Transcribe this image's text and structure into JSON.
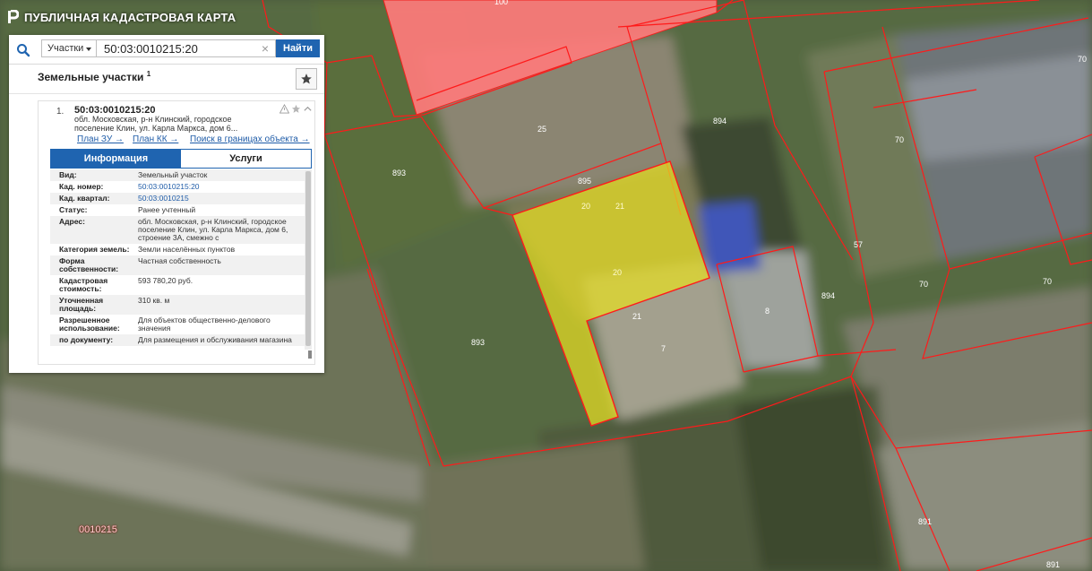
{
  "header": {
    "title": "ПУБЛИЧНАЯ КАДАСТРОВАЯ КАРТА"
  },
  "search": {
    "layer": "Участки",
    "value": "50:03:0010215:20",
    "button_label": "Найти",
    "clear_glyph": "×"
  },
  "results": {
    "title": "Земельные участки",
    "count": "1",
    "item": {
      "index": "1.",
      "cad_number": "50:03:0010215:20",
      "address_line1": "обл. Московская, р-н Клинский, городское",
      "address_line2": "поселение Клин, ул. Карла Маркса, дом 6...",
      "links": [
        "План ЗУ →",
        "План КК →",
        "Поиск в границах объекта →"
      ]
    }
  },
  "tabs": {
    "info": "Информация",
    "services": "Услуги"
  },
  "info_rows": [
    {
      "label": "Вид:",
      "value": "Земельный участок",
      "link": false
    },
    {
      "label": "Кад. номер:",
      "value": "50:03:0010215:20",
      "link": true
    },
    {
      "label": "Кад. квартал:",
      "value": "50:03:0010215",
      "link": true
    },
    {
      "label": "Статус:",
      "value": "Ранее учтенный",
      "link": false
    },
    {
      "label": "Адрес:",
      "value": "обл. Московская, р-н Клинский, городское поселение Клин, ул. Карла Маркса, дом 6, строение 3А, смежно с",
      "link": false
    },
    {
      "label": "Категория земель:",
      "value": "Земли населённых пунктов",
      "link": false
    },
    {
      "label": "Форма собственности:",
      "value": "Частная собственность",
      "link": false
    },
    {
      "label": "Кадастровая стоимость:",
      "value": "593 780,20 руб.",
      "link": false
    },
    {
      "label": "Уточненная площадь:",
      "value": "310 кв. м",
      "link": false
    },
    {
      "label": "Разрешенное использование:",
      "value": "Для объектов общественно-делового значения",
      "link": false
    },
    {
      "label": "по документу:",
      "value": "Для размещения и обслуживания магазина",
      "link": false
    }
  ],
  "map_labels": {
    "l_100": "100",
    "l_70a": "70",
    "l_70b": "70",
    "l_70c": "70",
    "l_70d": "70",
    "l_25": "25",
    "l_894a": "894",
    "l_894b": "894",
    "l_893a": "893",
    "l_893b": "893",
    "l_895": "895",
    "l_20a": "20",
    "l_21a": "21",
    "l_20b": "20",
    "l_21b": "21",
    "l_57": "57",
    "l_8": "8",
    "l_7": "7",
    "l_891a": "891",
    "l_891b": "891"
  },
  "quarter_label": "0010215",
  "colors": {
    "selected_parcel": "#e6de22",
    "highlight_parcel": "#ff7b7b",
    "boundary": "#ff1a1a",
    "accent": "#1f64b0"
  }
}
